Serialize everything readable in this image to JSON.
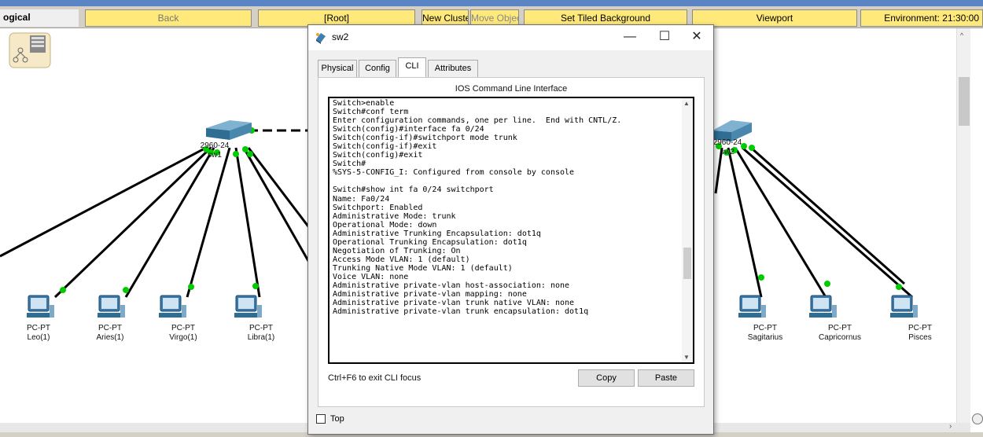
{
  "toolbar": {
    "logical_label": "ogical",
    "back_label": "Back",
    "root_label": "[Root]",
    "new_cluster_label": "New Cluster",
    "move_object_label": "Move Object",
    "set_tiled_background_label": "Set Tiled Background",
    "viewport_label": "Viewport",
    "environment_label": "Environment: 21:30:00"
  },
  "topology": {
    "left_switch": {
      "model": "2960-24",
      "name": "sw1"
    },
    "right_switch": {
      "model": "2960-24",
      "name": "sw2"
    },
    "pcs": [
      {
        "type": "PC-PT",
        "name": "Leo(1)"
      },
      {
        "type": "PC-PT",
        "name": "Aries(1)"
      },
      {
        "type": "PC-PT",
        "name": "Virgo(1)"
      },
      {
        "type": "PC-PT",
        "name": "Libra(1)"
      },
      {
        "type": "PC-PT",
        "name": "Sagitarius"
      },
      {
        "type": "PC-PT",
        "name": "Capricornus"
      },
      {
        "type": "PC-PT",
        "name": "Pisces"
      }
    ],
    "link_up_color": "#00cc00",
    "link_color": "#000000"
  },
  "dialog": {
    "title": "sw2",
    "minimize_glyph": "—",
    "maximize_glyph": "☐",
    "close_glyph": "✕",
    "tabs": [
      {
        "label": "Physical",
        "active": false
      },
      {
        "label": "Config",
        "active": false
      },
      {
        "label": "CLI",
        "active": true
      },
      {
        "label": "Attributes",
        "active": false
      }
    ],
    "cli_heading": "IOS Command Line Interface",
    "console_lines": [
      "Switch>enable",
      "Switch#conf term",
      "Enter configuration commands, one per line.  End with CNTL/Z.",
      "Switch(config)#interface fa 0/24",
      "Switch(config-if)#switchport mode trunk",
      "Switch(config-if)#exit",
      "Switch(config)#exit",
      "Switch#",
      "%SYS-5-CONFIG_I: Configured from console by console",
      "",
      "Switch#show int fa 0/24 switchport",
      "Name: Fa0/24",
      "Switchport: Enabled",
      "Administrative Mode: trunk",
      "Operational Mode: down",
      "Administrative Trunking Encapsulation: dot1q",
      "Operational Trunking Encapsulation: dot1q",
      "Negotiation of Trunking: On",
      "Access Mode VLAN: 1 (default)",
      "Trunking Native Mode VLAN: 1 (default)",
      "Voice VLAN: none",
      "Administrative private-vlan host-association: none",
      "Administrative private-vlan mapping: none",
      "Administrative private-vlan trunk native VLAN: none",
      "Administrative private-vlan trunk encapsulation: dot1q"
    ],
    "focus_hint": "Ctrl+F6 to exit CLI focus",
    "copy_label": "Copy",
    "paste_label": "Paste",
    "top_checkbox_label": "Top",
    "top_checked": false
  }
}
